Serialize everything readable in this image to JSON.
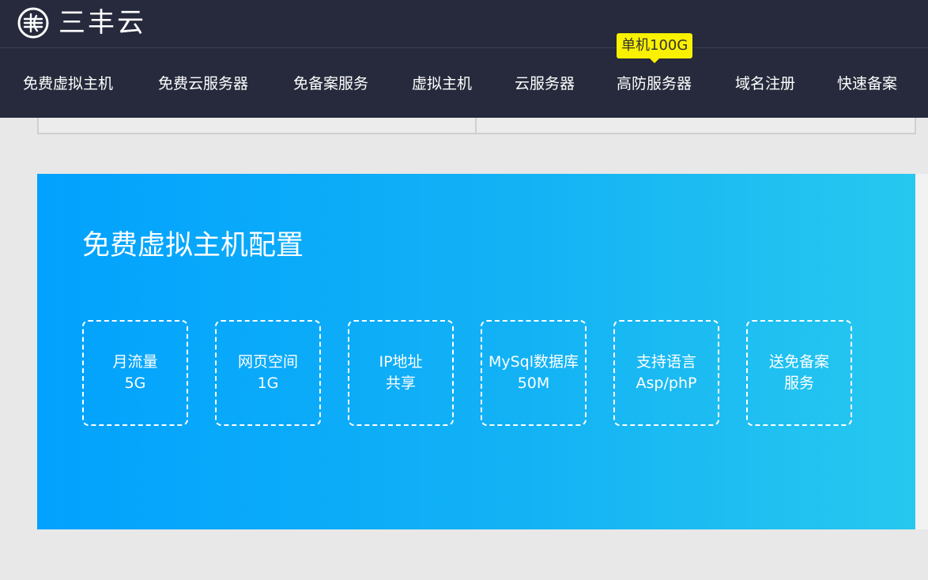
{
  "logo": {
    "text": "三丰云",
    "icon": "sanfeng-logo-icon"
  },
  "nav": {
    "items": [
      {
        "label": "免费虚拟主机"
      },
      {
        "label": "免费云服务器"
      },
      {
        "label": "免备案服务"
      },
      {
        "label": "虚拟主机"
      },
      {
        "label": "云服务器"
      },
      {
        "label": "高防服务器"
      },
      {
        "label": "域名注册"
      },
      {
        "label": "快速备案"
      }
    ],
    "badge": "单机100G"
  },
  "panel": {
    "title": "免费虚拟主机配置",
    "features": [
      {
        "line1": "月流量",
        "line2": "5G"
      },
      {
        "line1": "网页空间",
        "line2": "1G"
      },
      {
        "line1": "IP地址",
        "line2": "共享"
      },
      {
        "line1": "MySql数据库",
        "line2": "50M"
      },
      {
        "line1": "支持语言",
        "line2": "Asp/phP"
      },
      {
        "line1": "送免备案",
        "line2": "服务"
      }
    ]
  },
  "colors": {
    "header_bg": "#262a3c",
    "badge_bg": "#f9f100",
    "panel_gradient_start": "#02a2fe",
    "panel_gradient_end": "#27c8ef",
    "page_bg": "#e8e8e8"
  }
}
